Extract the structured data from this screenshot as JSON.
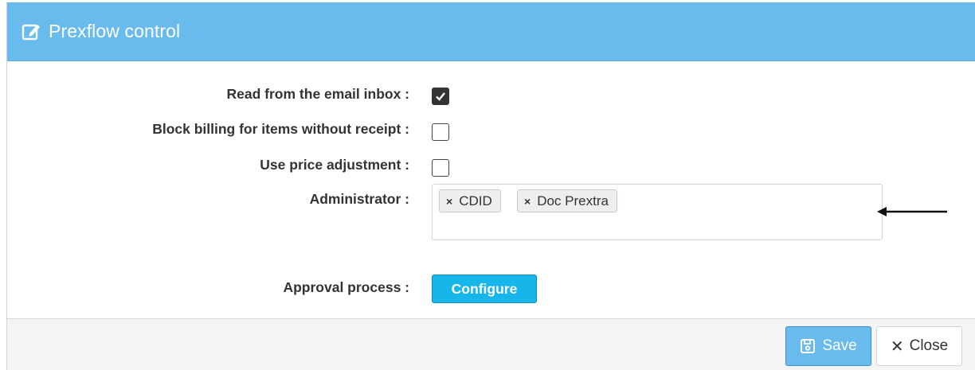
{
  "dialog": {
    "title": "Prexflow control",
    "title_icon": "edit-icon",
    "header_color": "#69bbee"
  },
  "form": {
    "read_email": {
      "label": "Read from the email inbox :",
      "checked": true
    },
    "block_billing": {
      "label": "Block billing for items without receipt :",
      "checked": false
    },
    "price_adjustment": {
      "label": "Use price adjustment :",
      "checked": false
    },
    "administrator": {
      "label": "Administrator :",
      "tags": [
        {
          "remove": "×",
          "text": "CDID"
        },
        {
          "remove": "×",
          "text": "Doc Prextra"
        }
      ]
    },
    "approval": {
      "label": "Approval process :",
      "button": "Configure"
    }
  },
  "footer": {
    "save_label": "Save",
    "save_icon": "floppy-disk-icon",
    "close_label": "Close",
    "close_icon": "close-icon",
    "close_glyph": "✕"
  },
  "annotation": {
    "icon": "arrow-left-icon"
  }
}
